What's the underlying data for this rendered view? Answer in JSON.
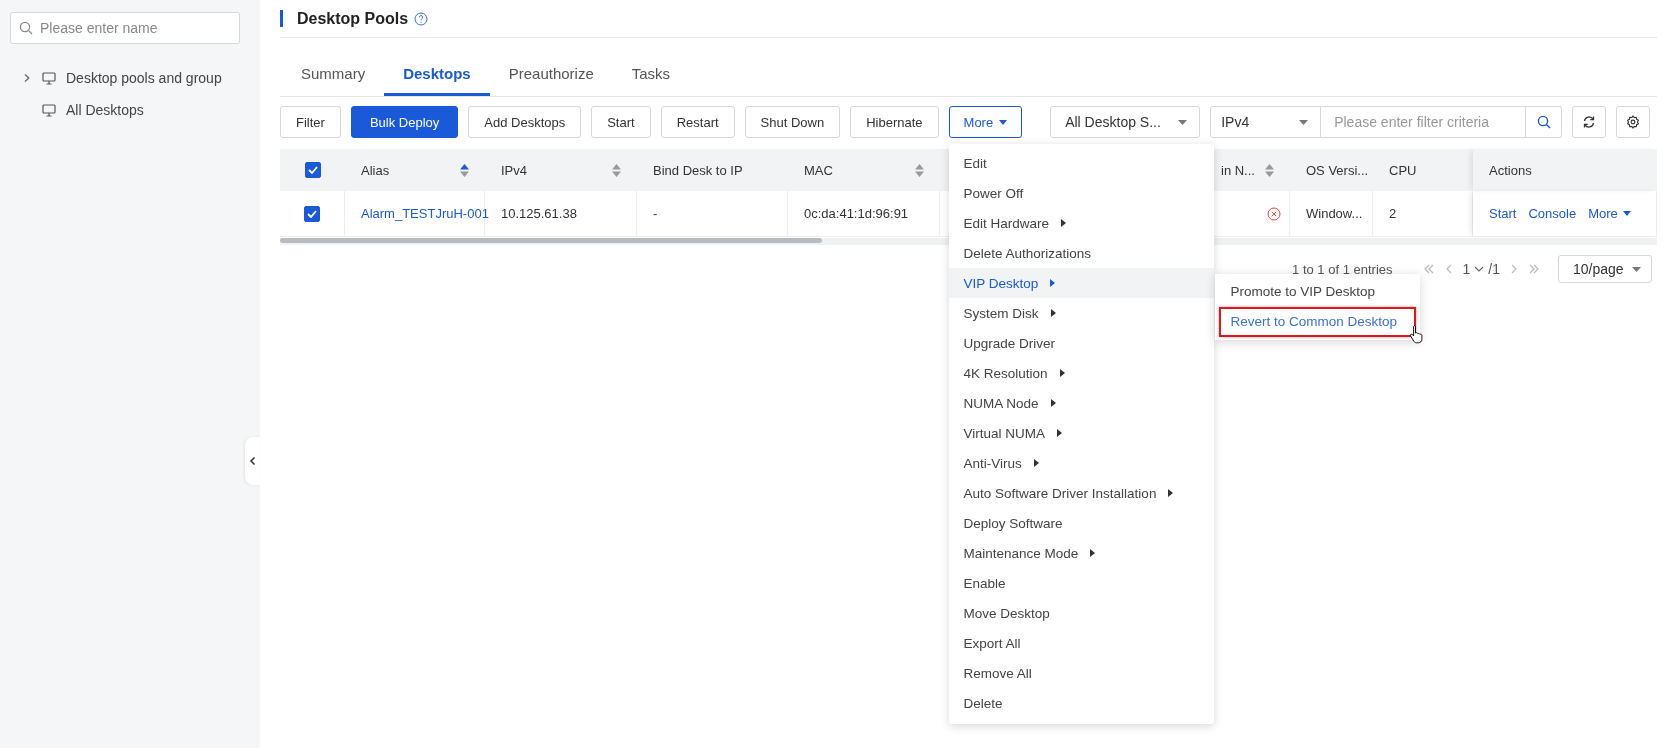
{
  "sidebar": {
    "search": {
      "placeholder": "Please enter name"
    },
    "tree": [
      {
        "label": "Desktop pools and group",
        "kind": "group",
        "expanded": false
      },
      {
        "label": "All Desktops",
        "kind": "leaf"
      }
    ]
  },
  "page": {
    "title": "Desktop Pools"
  },
  "tabs": [
    {
      "label": "Summary",
      "selected": false
    },
    {
      "label": "Desktops",
      "selected": true
    },
    {
      "label": "Preauthorize",
      "selected": false
    },
    {
      "label": "Tasks",
      "selected": false
    }
  ],
  "toolbar": {
    "buttons": [
      {
        "label": "Filter",
        "kind": "default"
      },
      {
        "label": "Bulk Deploy",
        "kind": "primary"
      },
      {
        "label": "Add Desktops",
        "kind": "default"
      },
      {
        "label": "Start",
        "kind": "default"
      },
      {
        "label": "Restart",
        "kind": "default"
      },
      {
        "label": "Shut Down",
        "kind": "default"
      },
      {
        "label": "Hibernate",
        "kind": "default"
      }
    ],
    "more": {
      "label": "More",
      "open": true,
      "items": [
        {
          "label": "Edit",
          "submenu": false,
          "selected": false
        },
        {
          "label": "Power Off",
          "submenu": false,
          "selected": false
        },
        {
          "label": "Edit Hardware",
          "submenu": true,
          "selected": false
        },
        {
          "label": "Delete Authorizations",
          "submenu": false,
          "selected": false
        },
        {
          "label": "VIP Desktop",
          "submenu": true,
          "selected": true,
          "children": [
            {
              "label": "Promote to VIP Desktop",
              "selected": false
            },
            {
              "label": "Revert to Common Desktop",
              "selected": true
            }
          ]
        },
        {
          "label": "System Disk",
          "submenu": true,
          "selected": false
        },
        {
          "label": "Upgrade Driver",
          "submenu": false,
          "selected": false
        },
        {
          "label": "4K Resolution",
          "submenu": true,
          "selected": false
        },
        {
          "label": "NUMA Node",
          "submenu": true,
          "selected": false
        },
        {
          "label": "Virtual NUMA",
          "submenu": true,
          "selected": false
        },
        {
          "label": "Anti-Virus",
          "submenu": true,
          "selected": false
        },
        {
          "label": "Auto Software Driver Installation",
          "submenu": true,
          "selected": false
        },
        {
          "label": "Deploy Software",
          "submenu": false,
          "selected": false
        },
        {
          "label": "Maintenance Mode",
          "submenu": true,
          "selected": false
        },
        {
          "label": "Enable",
          "submenu": false,
          "selected": false
        },
        {
          "label": "Move Desktop",
          "submenu": false,
          "selected": false
        },
        {
          "label": "Export All",
          "submenu": false,
          "selected": false
        },
        {
          "label": "Remove All",
          "submenu": false,
          "selected": false
        },
        {
          "label": "Delete",
          "submenu": false,
          "selected": false
        }
      ]
    },
    "status_select": {
      "value": "All Desktop S..."
    },
    "filter_type": {
      "value": "IPv4"
    },
    "filter": {
      "placeholder": "Please enter filter criteria"
    }
  },
  "table": {
    "all_checked": true,
    "columns": [
      {
        "label": "Alias",
        "sortable": true,
        "sorted_ascending": true
      },
      {
        "label": "IPv4",
        "sortable": true,
        "sorted_ascending": false
      },
      {
        "label": "Bind Desk to IP",
        "sortable": false
      },
      {
        "label": "MAC",
        "sortable": true,
        "sorted_ascending": false
      },
      {
        "sortable": false
      },
      {
        "label": "in N...",
        "sortable": true,
        "sorted_ascending": false
      },
      {
        "label": "OS Versi...",
        "sortable": false
      },
      {
        "label": "CPU",
        "sortable": false
      },
      {
        "label": "Actions",
        "sortable": false
      }
    ],
    "rows": [
      {
        "checked": true,
        "alias": "Alarm_TESTJruH-001",
        "ipv4": "10.125.61.38",
        "bind_ip": "-",
        "mac": "0c:da:41:1d:96:91",
        "error": true,
        "os_version": "Window...",
        "cpu": "2",
        "actions": [
          {
            "label": "Start",
            "dropdown": false
          },
          {
            "label": "Console",
            "dropdown": false
          },
          {
            "label": "More",
            "dropdown": true
          }
        ]
      }
    ]
  },
  "pagination": {
    "summary": "1 to 1 of 1 entries",
    "page": "1",
    "total": "/1",
    "page_size": "10/page"
  }
}
